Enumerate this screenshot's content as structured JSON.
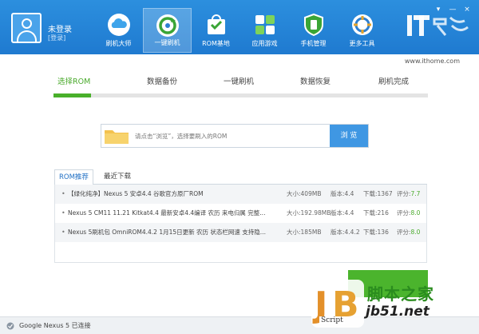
{
  "user": {
    "name": "未登录",
    "login_link": "[登录]"
  },
  "nav": {
    "items": [
      {
        "label": "刷机大师",
        "icon": "cloud-icon"
      },
      {
        "label": "一键刷机",
        "icon": "refresh-icon"
      },
      {
        "label": "ROM基地",
        "icon": "shopping-bag-icon"
      },
      {
        "label": "应用游戏",
        "icon": "app-grid-icon"
      },
      {
        "label": "手机管理",
        "icon": "shield-icon"
      },
      {
        "label": "更多工具",
        "icon": "tools-icon"
      }
    ],
    "active_index": 1
  },
  "window_controls": {
    "skin": "▾",
    "minimize": "—",
    "close": "×"
  },
  "watermark": {
    "ithome_text": "IT之家",
    "ithome_url": "www.ithome.com",
    "jb_name": "脚本之家",
    "jb_domain": "jb51.net",
    "jb_script": "Script"
  },
  "steps": {
    "items": [
      "选择ROM",
      "数据备份",
      "一键刷机",
      "数据恢复",
      "刷机完成"
    ],
    "active_index": 0,
    "progress_fraction": 0.1
  },
  "file_selector": {
    "placeholder": "请点击“浏览”，选择要刷入的ROM",
    "browse_label": "浏 览"
  },
  "tabs": [
    {
      "label": "ROM推荐",
      "active": true
    },
    {
      "label": "最近下载",
      "active": false
    }
  ],
  "rom_list": [
    {
      "title": "【绿化纯净】Nexus 5 安卓4.4 谷歌官方原厂ROM",
      "size": "大小:409MB",
      "version": "版本:4.4",
      "downloads": "下载:1367",
      "score_label": "评分:",
      "score": "7.7"
    },
    {
      "title": "Nexus 5 CM11 11.21 Kitkat4.4 最新安卓4.4编译 农历 来电归属 完整...",
      "size": "大小:192.98MB",
      "version": "版本:4.4",
      "downloads": "下载:216",
      "score_label": "评分:",
      "score": "8.0"
    },
    {
      "title": "Nexus 5刷机包 OmniROM4.4.2 1月15日更新 农历 状态栏网速 支持隐...",
      "size": "大小:185MB",
      "version": "版本:4.4.2",
      "downloads": "下载:136",
      "score_label": "评分:",
      "score": "8.0"
    }
  ],
  "status": {
    "text": "Google Nexus 5 已连接"
  },
  "colors": {
    "header": "#2383d6",
    "accent_green": "#49b02a",
    "browse_blue": "#3f97e3"
  }
}
